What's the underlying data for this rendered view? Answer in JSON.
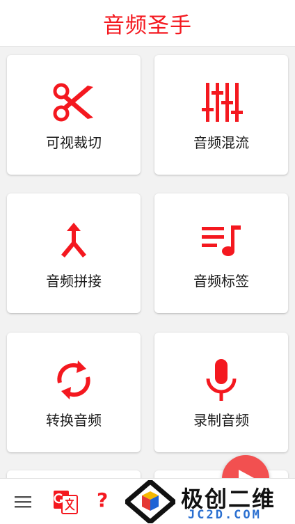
{
  "header": {
    "title": "音频圣手"
  },
  "colors": {
    "accent": "#f4181f",
    "fab": "#f25050",
    "watermark_blue": "#2a6fd0"
  },
  "features": [
    {
      "label": "可视裁切",
      "icon": "scissors-icon"
    },
    {
      "label": "音频混流",
      "icon": "equalizer-sliders-icon"
    },
    {
      "label": "音频拼接",
      "icon": "merge-arrow-icon"
    },
    {
      "label": "音频标签",
      "icon": "playlist-note-icon"
    },
    {
      "label": "转换音频",
      "icon": "sync-arrows-icon"
    },
    {
      "label": "录制音频",
      "icon": "microphone-icon"
    }
  ],
  "bottom_bar": {
    "menu_icon": "hamburger-menu-icon",
    "translate_icon": "translate-icon",
    "help_label": "?"
  },
  "watermark": {
    "brand": "极创二维",
    "domain": "JC2D.COM"
  }
}
